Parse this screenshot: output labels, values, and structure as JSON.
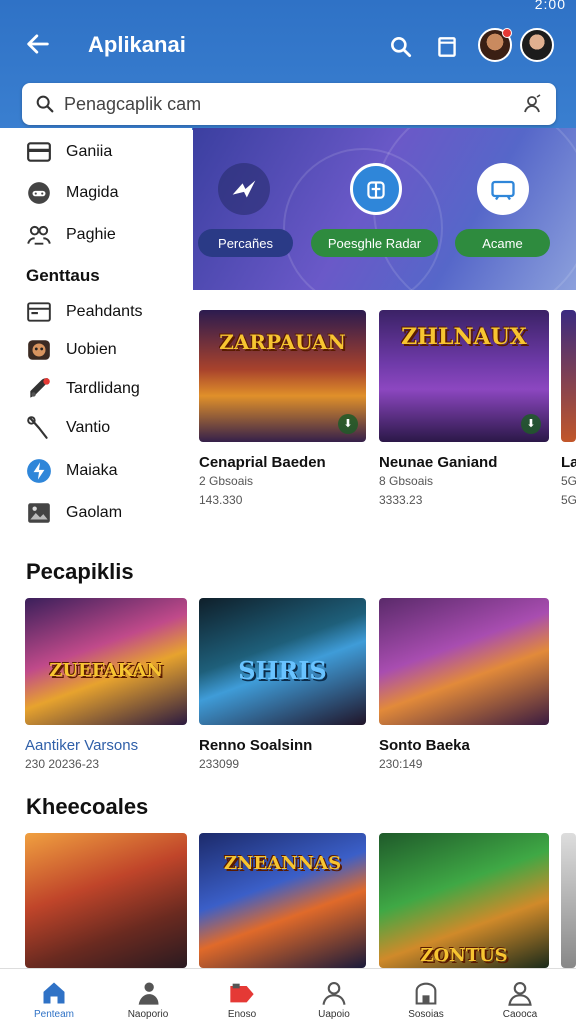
{
  "status": {
    "time": "2:00"
  },
  "header": {
    "title": "Aplikanai"
  },
  "search": {
    "placeholder": "Penagcaplik cam"
  },
  "sidebar": {
    "items": [
      {
        "label": "Ganiia",
        "icon": "card-icon"
      },
      {
        "label": "Magida",
        "icon": "gamepad-icon"
      },
      {
        "label": "Paghie",
        "icon": "people-icon"
      }
    ],
    "heading": "Genttaus",
    "categories": [
      {
        "label": "Peahdants",
        "icon": "window-icon"
      },
      {
        "label": "Uobien",
        "icon": "mask-icon"
      },
      {
        "label": "Tardlidang",
        "icon": "rocket-icon"
      },
      {
        "label": "Vantio",
        "icon": "sword-icon"
      },
      {
        "label": "Maiaka",
        "icon": "bolt-icon"
      },
      {
        "label": "Gaolam",
        "icon": "image-icon"
      }
    ]
  },
  "banner": {
    "pills": [
      "Percañes",
      "Poesghle Radar",
      "Acame"
    ]
  },
  "featured": [
    {
      "art": "ZARPAUAN",
      "title": "Cenaprial Baeden",
      "line1": "2 Gbsoais",
      "line2": "143.330"
    },
    {
      "art": "ZHLNAUX",
      "title": "Neunae Ganiand",
      "line1": "8 Gbsoais",
      "line2": "3333.23"
    },
    {
      "art": "",
      "title": "La",
      "line1": "5G",
      "line2": "5G"
    }
  ],
  "section1": {
    "title": "Pecapiklis",
    "cards": [
      {
        "art": "ZUEFAKAN",
        "title": "Aantiker Varsons",
        "sub": "230 20236-23"
      },
      {
        "art": "SHRIS",
        "title": "Renno Soalsinn",
        "sub": "233099"
      },
      {
        "art": "",
        "title": "Sonto Baeka",
        "sub": "230:149"
      }
    ]
  },
  "section2": {
    "title": "Kheecoales",
    "cards": [
      {
        "art": ""
      },
      {
        "art": "ZNEANNAS"
      },
      {
        "art": "ZONTUS"
      }
    ]
  },
  "nav": [
    {
      "label": "Penteam",
      "icon": "home-icon",
      "active": true
    },
    {
      "label": "Naoporio",
      "icon": "person-icon",
      "active": false
    },
    {
      "label": "Enoso",
      "icon": "tag-icon",
      "active": false
    },
    {
      "label": "Uapoio",
      "icon": "user-icon",
      "active": false
    },
    {
      "label": "Sosoias",
      "icon": "store-icon",
      "active": false
    },
    {
      "label": "Caooca",
      "icon": "profile-icon",
      "active": false
    }
  ],
  "colors": {
    "primary": "#2f72c6",
    "green": "#2e8b3e",
    "navy": "#2a3a86"
  }
}
